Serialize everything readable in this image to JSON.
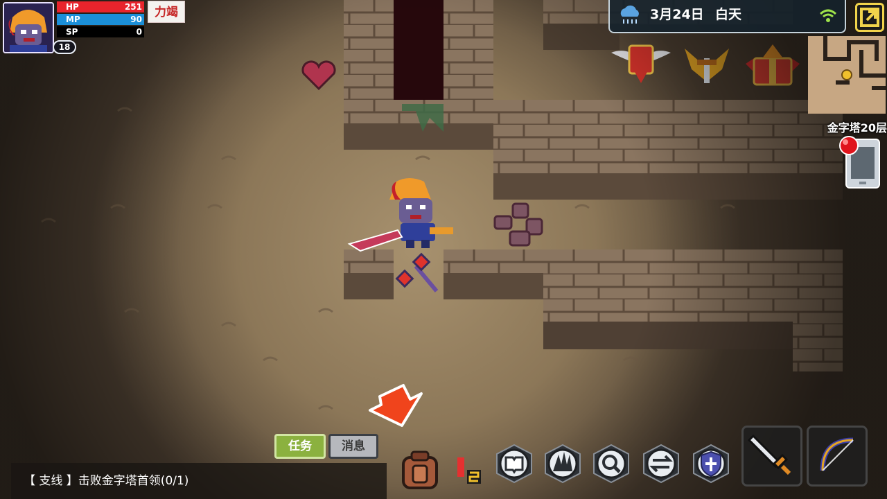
{
  "player": {
    "hp_label": "HP",
    "hp_value": "251",
    "mp_label": "MP",
    "mp_value": "90",
    "sp_label": "SP",
    "sp_value": "0",
    "hp_fill": 1.0,
    "mp_fill": 1.0,
    "sp_fill": 0.0,
    "level": "18",
    "status_tag": "力竭"
  },
  "top_bar": {
    "date": "3月24日",
    "time_of_day": "白天",
    "weather_icon": "rain-cloud-icon",
    "signal_icon": "wifi-icon"
  },
  "map": {
    "floor_label": "金字塔20层"
  },
  "bottom": {
    "quest_tab": "任务",
    "message_tab": "消息",
    "quest_text": "【 支线 】击败金字塔首领(0/1)"
  },
  "colors": {
    "hp": "#e8242c",
    "mp": "#1b8fd8",
    "quest_tab": "#8bb13f",
    "accent": "#f1d34b"
  }
}
